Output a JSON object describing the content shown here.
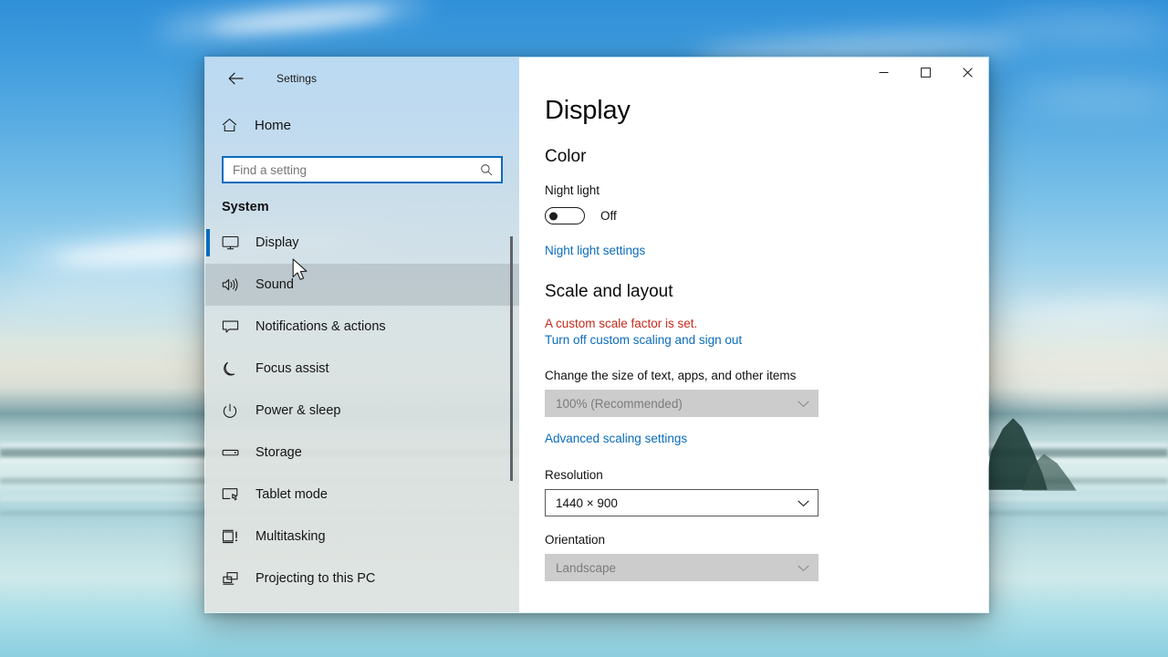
{
  "window": {
    "app_title": "Settings",
    "controls": {
      "minimize": "minimize-button",
      "maximize": "maximize-button",
      "close": "close-button"
    }
  },
  "sidebar": {
    "back_label": "Back",
    "home_label": "Home",
    "search": {
      "placeholder": "Find a setting",
      "value": ""
    },
    "group_title": "System",
    "items": [
      {
        "label": "Display",
        "icon": "monitor-icon",
        "selected": true,
        "hovered": false
      },
      {
        "label": "Sound",
        "icon": "speaker-icon",
        "selected": false,
        "hovered": true
      },
      {
        "label": "Notifications & actions",
        "icon": "message-icon",
        "selected": false,
        "hovered": false
      },
      {
        "label": "Focus assist",
        "icon": "moon-icon",
        "selected": false,
        "hovered": false
      },
      {
        "label": "Power & sleep",
        "icon": "power-icon",
        "selected": false,
        "hovered": false
      },
      {
        "label": "Storage",
        "icon": "drive-icon",
        "selected": false,
        "hovered": false
      },
      {
        "label": "Tablet mode",
        "icon": "tablet-icon",
        "selected": false,
        "hovered": false
      },
      {
        "label": "Multitasking",
        "icon": "multitask-icon",
        "selected": false,
        "hovered": false
      },
      {
        "label": "Projecting to this PC",
        "icon": "project-icon",
        "selected": false,
        "hovered": false
      }
    ]
  },
  "main": {
    "page_title": "Display",
    "color_section": {
      "heading": "Color",
      "night_light_label": "Night light",
      "night_light_state": "Off",
      "night_light_settings_link": "Night light settings"
    },
    "scale_section": {
      "heading": "Scale and layout",
      "warning": "A custom scale factor is set.",
      "turn_off_link": "Turn off custom scaling and sign out",
      "scale_desc": "Change the size of text, apps, and other items",
      "scale_value": "100% (Recommended)",
      "scale_disabled": true,
      "advanced_link": "Advanced scaling settings",
      "resolution_label": "Resolution",
      "resolution_value": "1440 × 900",
      "resolution_disabled": false,
      "orientation_label": "Orientation",
      "orientation_value": "Landscape",
      "orientation_disabled": true
    }
  },
  "colors": {
    "accent": "#0a6cbd",
    "warning": "#c42b1c",
    "link": "#0a6cbd",
    "content_bg": "#ffffff",
    "disabled_bg": "#cccccc"
  }
}
